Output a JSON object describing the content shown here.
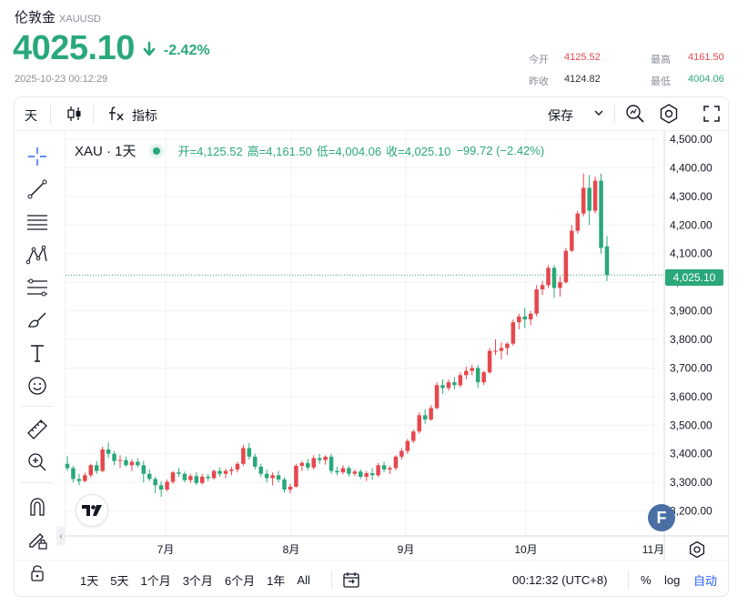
{
  "header": {
    "name": "伦敦金",
    "symbol": "XAUUSD",
    "price": "4025.10",
    "change_pct": "-2.42%",
    "timestamp": "2025-10-23 00:12:29",
    "stats": {
      "open_label": "今开",
      "open_value": "4125.52",
      "high_label": "最高",
      "high_value": "4161.50",
      "prev_label": "昨收",
      "prev_value": "4124.82",
      "low_label": "最低",
      "low_value": "4004.06"
    }
  },
  "toolbar": {
    "interval": "天",
    "indicators": "指标",
    "save": "保存"
  },
  "legend": {
    "title": "XAU · 1天",
    "open": "开=4,125.52",
    "high": "高=4,161.50",
    "low": "低=4,004.06",
    "close": "收=4,025.10",
    "change": "−99.72 (−2.42%)"
  },
  "current_price_label": "4,025.10",
  "bottom": {
    "ranges": [
      "1天",
      "5天",
      "1个月",
      "3个月",
      "6个月",
      "1年",
      "All"
    ],
    "clock": "00:12:32 (UTC+8)",
    "percent": "%",
    "log": "log",
    "auto": "自动"
  },
  "colors": {
    "up": "#e5484d",
    "down": "#2aa87a",
    "accent": "#2aa87a",
    "brand_badge": "#4a6fa5"
  },
  "icons": [
    "crosshair-icon",
    "trend-line-icon",
    "horizontal-lines-icon",
    "pattern-icon",
    "fib-icon",
    "brush-icon",
    "text-icon",
    "emoji-icon",
    "ruler-icon",
    "zoom-in-icon",
    "magnet-icon",
    "lock-draw-icon",
    "lock-icon",
    "candle-type-icon",
    "fx-icon",
    "chevron-down-icon",
    "search-chart-icon",
    "settings-icon",
    "fullscreen-icon",
    "compare-icon",
    "gear-icon",
    "arrow-down-icon"
  ],
  "chart_data": {
    "type": "candlestick",
    "title": "XAU · 1天",
    "x_tick_labels": [
      "7月",
      "8月",
      "9月",
      "10月",
      "11月"
    ],
    "y_ticks": [
      3200,
      3300,
      3400,
      3500,
      3600,
      3700,
      3800,
      3900,
      4000,
      4100,
      4200,
      4300,
      4400,
      4500
    ],
    "y_tick_labels": [
      "3,200.00",
      "3,300.00",
      "3,400.00",
      "3,500.00",
      "3,600.00",
      "3,700.00",
      "3,800.00",
      "3,900.00",
      "4,000.00",
      "4,100.00",
      "4,200.00",
      "4,300.00",
      "4,400.00",
      "4,500.00"
    ],
    "ylim": [
      3125,
      4530
    ],
    "current_price": 4025.1,
    "up_color": "#e5484d",
    "down_color": "#2aa87a",
    "grid": true,
    "candles_note_unit": "USD per ounce, daily",
    "candles": [
      {
        "o": 3365,
        "h": 3392,
        "l": 3340,
        "c": 3350
      },
      {
        "o": 3350,
        "h": 3358,
        "l": 3300,
        "c": 3312
      },
      {
        "o": 3312,
        "h": 3330,
        "l": 3290,
        "c": 3305
      },
      {
        "o": 3305,
        "h": 3335,
        "l": 3300,
        "c": 3325
      },
      {
        "o": 3325,
        "h": 3365,
        "l": 3318,
        "c": 3360
      },
      {
        "o": 3360,
        "h": 3375,
        "l": 3330,
        "c": 3340
      },
      {
        "o": 3340,
        "h": 3425,
        "l": 3335,
        "c": 3415
      },
      {
        "o": 3415,
        "h": 3440,
        "l": 3385,
        "c": 3400
      },
      {
        "o": 3400,
        "h": 3410,
        "l": 3360,
        "c": 3375
      },
      {
        "o": 3375,
        "h": 3395,
        "l": 3350,
        "c": 3378
      },
      {
        "o": 3378,
        "h": 3390,
        "l": 3355,
        "c": 3360
      },
      {
        "o": 3360,
        "h": 3380,
        "l": 3340,
        "c": 3372
      },
      {
        "o": 3372,
        "h": 3385,
        "l": 3352,
        "c": 3360
      },
      {
        "o": 3360,
        "h": 3375,
        "l": 3300,
        "c": 3330
      },
      {
        "o": 3330,
        "h": 3345,
        "l": 3305,
        "c": 3312
      },
      {
        "o": 3312,
        "h": 3320,
        "l": 3262,
        "c": 3290
      },
      {
        "o": 3290,
        "h": 3305,
        "l": 3250,
        "c": 3275
      },
      {
        "o": 3275,
        "h": 3310,
        "l": 3268,
        "c": 3302
      },
      {
        "o": 3302,
        "h": 3340,
        "l": 3295,
        "c": 3335
      },
      {
        "o": 3335,
        "h": 3350,
        "l": 3320,
        "c": 3330
      },
      {
        "o": 3330,
        "h": 3338,
        "l": 3300,
        "c": 3308
      },
      {
        "o": 3308,
        "h": 3330,
        "l": 3298,
        "c": 3322
      },
      {
        "o": 3322,
        "h": 3335,
        "l": 3290,
        "c": 3298
      },
      {
        "o": 3298,
        "h": 3330,
        "l": 3292,
        "c": 3320
      },
      {
        "o": 3320,
        "h": 3330,
        "l": 3305,
        "c": 3315
      },
      {
        "o": 3315,
        "h": 3345,
        "l": 3310,
        "c": 3340
      },
      {
        "o": 3340,
        "h": 3352,
        "l": 3320,
        "c": 3330
      },
      {
        "o": 3330,
        "h": 3348,
        "l": 3315,
        "c": 3340
      },
      {
        "o": 3340,
        "h": 3355,
        "l": 3325,
        "c": 3345
      },
      {
        "o": 3345,
        "h": 3372,
        "l": 3335,
        "c": 3365
      },
      {
        "o": 3365,
        "h": 3432,
        "l": 3358,
        "c": 3420
      },
      {
        "o": 3420,
        "h": 3438,
        "l": 3380,
        "c": 3390
      },
      {
        "o": 3390,
        "h": 3400,
        "l": 3345,
        "c": 3355
      },
      {
        "o": 3355,
        "h": 3365,
        "l": 3320,
        "c": 3330
      },
      {
        "o": 3330,
        "h": 3345,
        "l": 3300,
        "c": 3315
      },
      {
        "o": 3315,
        "h": 3335,
        "l": 3290,
        "c": 3325
      },
      {
        "o": 3325,
        "h": 3340,
        "l": 3300,
        "c": 3310
      },
      {
        "o": 3310,
        "h": 3318,
        "l": 3265,
        "c": 3275
      },
      {
        "o": 3275,
        "h": 3295,
        "l": 3262,
        "c": 3285
      },
      {
        "o": 3285,
        "h": 3365,
        "l": 3282,
        "c": 3358
      },
      {
        "o": 3358,
        "h": 3375,
        "l": 3340,
        "c": 3368
      },
      {
        "o": 3368,
        "h": 3382,
        "l": 3342,
        "c": 3352
      },
      {
        "o": 3352,
        "h": 3395,
        "l": 3345,
        "c": 3385
      },
      {
        "o": 3385,
        "h": 3400,
        "l": 3365,
        "c": 3378
      },
      {
        "o": 3378,
        "h": 3395,
        "l": 3362,
        "c": 3390
      },
      {
        "o": 3390,
        "h": 3400,
        "l": 3330,
        "c": 3340
      },
      {
        "o": 3340,
        "h": 3355,
        "l": 3325,
        "c": 3335
      },
      {
        "o": 3335,
        "h": 3360,
        "l": 3328,
        "c": 3350
      },
      {
        "o": 3350,
        "h": 3358,
        "l": 3320,
        "c": 3330
      },
      {
        "o": 3330,
        "h": 3345,
        "l": 3322,
        "c": 3338
      },
      {
        "o": 3338,
        "h": 3345,
        "l": 3312,
        "c": 3320
      },
      {
        "o": 3320,
        "h": 3340,
        "l": 3305,
        "c": 3332
      },
      {
        "o": 3332,
        "h": 3350,
        "l": 3310,
        "c": 3325
      },
      {
        "o": 3325,
        "h": 3368,
        "l": 3318,
        "c": 3360
      },
      {
        "o": 3360,
        "h": 3372,
        "l": 3335,
        "c": 3345
      },
      {
        "o": 3345,
        "h": 3358,
        "l": 3330,
        "c": 3350
      },
      {
        "o": 3350,
        "h": 3395,
        "l": 3342,
        "c": 3390
      },
      {
        "o": 3390,
        "h": 3420,
        "l": 3380,
        "c": 3410
      },
      {
        "o": 3410,
        "h": 3452,
        "l": 3400,
        "c": 3445
      },
      {
        "o": 3445,
        "h": 3485,
        "l": 3438,
        "c": 3478
      },
      {
        "o": 3478,
        "h": 3545,
        "l": 3470,
        "c": 3535
      },
      {
        "o": 3535,
        "h": 3555,
        "l": 3505,
        "c": 3520
      },
      {
        "o": 3520,
        "h": 3570,
        "l": 3515,
        "c": 3560
      },
      {
        "o": 3560,
        "h": 3650,
        "l": 3555,
        "c": 3640
      },
      {
        "o": 3640,
        "h": 3660,
        "l": 3610,
        "c": 3630
      },
      {
        "o": 3630,
        "h": 3660,
        "l": 3620,
        "c": 3650
      },
      {
        "o": 3650,
        "h": 3668,
        "l": 3625,
        "c": 3640
      },
      {
        "o": 3640,
        "h": 3685,
        "l": 3632,
        "c": 3675
      },
      {
        "o": 3675,
        "h": 3705,
        "l": 3660,
        "c": 3690
      },
      {
        "o": 3690,
        "h": 3712,
        "l": 3675,
        "c": 3700
      },
      {
        "o": 3700,
        "h": 3710,
        "l": 3630,
        "c": 3650
      },
      {
        "o": 3650,
        "h": 3690,
        "l": 3640,
        "c": 3685
      },
      {
        "o": 3685,
        "h": 3770,
        "l": 3680,
        "c": 3760
      },
      {
        "o": 3760,
        "h": 3800,
        "l": 3745,
        "c": 3760
      },
      {
        "o": 3760,
        "h": 3790,
        "l": 3730,
        "c": 3770
      },
      {
        "o": 3770,
        "h": 3790,
        "l": 3745,
        "c": 3785
      },
      {
        "o": 3785,
        "h": 3870,
        "l": 3778,
        "c": 3860
      },
      {
        "o": 3860,
        "h": 3890,
        "l": 3835,
        "c": 3880
      },
      {
        "o": 3880,
        "h": 3910,
        "l": 3840,
        "c": 3870
      },
      {
        "o": 3870,
        "h": 3900,
        "l": 3850,
        "c": 3890
      },
      {
        "o": 3890,
        "h": 3990,
        "l": 3880,
        "c": 3975
      },
      {
        "o": 3975,
        "h": 4005,
        "l": 3955,
        "c": 3990
      },
      {
        "o": 3990,
        "h": 4060,
        "l": 3980,
        "c": 4050
      },
      {
        "o": 4050,
        "h": 4060,
        "l": 3945,
        "c": 3980
      },
      {
        "o": 3980,
        "h": 4020,
        "l": 3950,
        "c": 4000
      },
      {
        "o": 4000,
        "h": 4120,
        "l": 3995,
        "c": 4110
      },
      {
        "o": 4110,
        "h": 4200,
        "l": 4105,
        "c": 4180
      },
      {
        "o": 4180,
        "h": 4250,
        "l": 4170,
        "c": 4240
      },
      {
        "o": 4240,
        "h": 4380,
        "l": 4230,
        "c": 4330
      },
      {
        "o": 4330,
        "h": 4375,
        "l": 4200,
        "c": 4250
      },
      {
        "o": 4250,
        "h": 4370,
        "l": 4240,
        "c": 4355
      },
      {
        "o": 4355,
        "h": 4380,
        "l": 4100,
        "c": 4120
      },
      {
        "o": 4125.52,
        "h": 4161.5,
        "l": 4004.06,
        "c": 4025.1
      }
    ]
  }
}
